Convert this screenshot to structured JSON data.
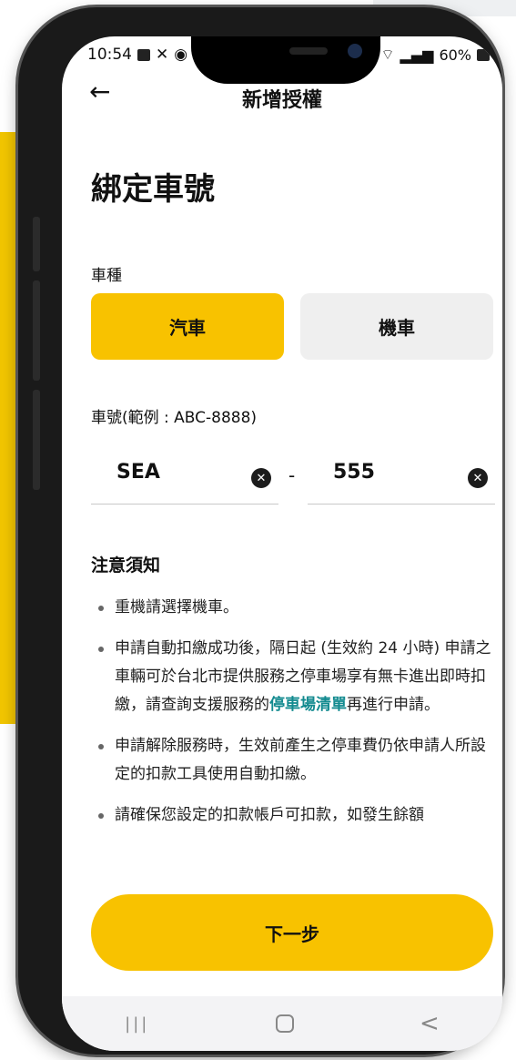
{
  "status_bar": {
    "time": "10:54",
    "battery": "60%"
  },
  "header": {
    "back_icon": "←",
    "title": "新增授權"
  },
  "page_title": "綁定車號",
  "vehicle_type": {
    "label": "車種",
    "options": [
      {
        "label": "汽車",
        "selected": true
      },
      {
        "label": "機車",
        "selected": false
      }
    ],
    "selected_color": "#f8c200"
  },
  "plate": {
    "label": "車號(範例 : ABC-8888)",
    "part1": "SEA",
    "separator": "-",
    "part2": "555"
  },
  "notice": {
    "title": "注意須知",
    "item1": "重機請選擇機車。",
    "item2_text": "申請自動扣繳成功後，隔日起 (生效約 24 小時) 申請之車輛可於台北市提供服務之停車場享有無卡進出即時扣繳，請查詢支援服務的",
    "item2_link": "停車場清單",
    "item2_tail": "再進行申請。",
    "item3": "申請解除服務時，生效前產生之停車費仍依申請人所設定的扣款工具使用自動扣繳。",
    "item4": "請確保您設定的扣款帳戶可扣款，如發生餘額"
  },
  "next_button": {
    "label": "下一步"
  },
  "navbar": {
    "recent": "|||",
    "back": "<"
  },
  "icons": {
    "clear": "clear-icon",
    "back": "arrow-left-icon"
  },
  "colors": {
    "accent": "#f8c200",
    "link": "#128a8f"
  }
}
